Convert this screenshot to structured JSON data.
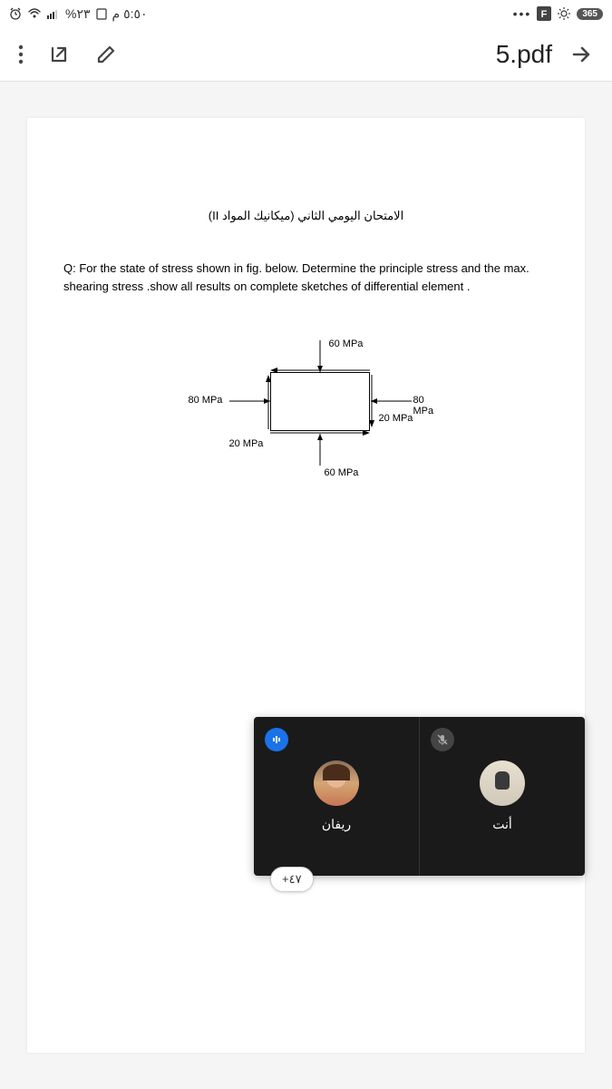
{
  "status_bar": {
    "time": "٥:٥٠ م",
    "battery": "٢٣%"
  },
  "header": {
    "file_title": "5.pdf"
  },
  "document": {
    "exam_title": "الامتحان اليومي الثاني (ميكانيك المواد II)",
    "question": "Q: For the state of stress shown in fig. below. Determine the principle stress and the max. shearing stress .show all results on complete sketches of differential element .",
    "labels": {
      "top": "60 MPa",
      "bottom": "60 MPa",
      "left": "80 MPa",
      "right": "80 MPa",
      "shear_right": "20 MPa",
      "shear_left": "20 MPa"
    }
  },
  "meeting": {
    "participant1": "ريفان",
    "participant2": "أنت",
    "more_count": "٤٧+"
  }
}
